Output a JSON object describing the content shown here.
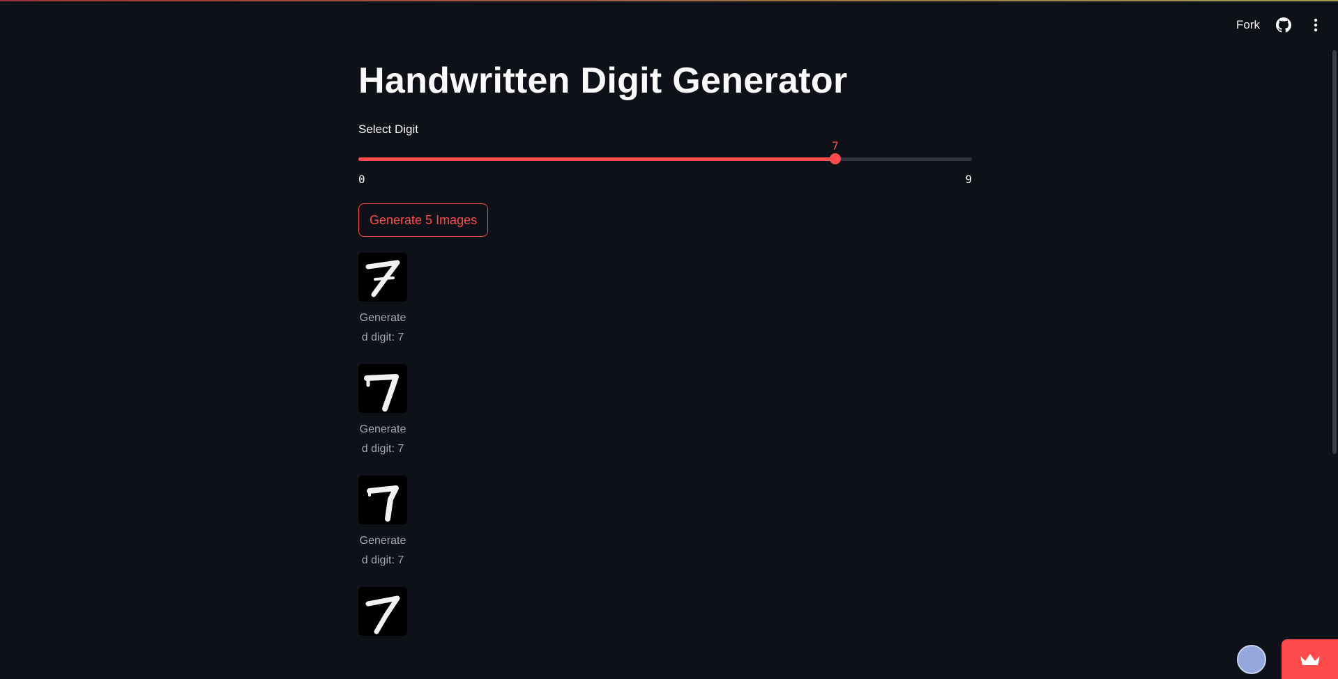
{
  "header": {
    "fork_label": "Fork",
    "github_icon": "github-icon",
    "menu_icon": "kebab-menu-icon"
  },
  "main": {
    "title": "Handwritten Digit Generator",
    "slider": {
      "label": "Select Digit",
      "value": "7",
      "min": "0",
      "max": "9",
      "fill_fraction": 0.7778
    },
    "button_label": "Generate 5 Images",
    "images": [
      {
        "caption": "Generated digit: 7",
        "digit": "7"
      },
      {
        "caption": "Generated digit: 7",
        "digit": "7"
      },
      {
        "caption": "Generated digit: 7",
        "digit": "7"
      },
      {
        "caption": "",
        "digit": "7"
      }
    ]
  },
  "colors": {
    "background": "#0e1117",
    "accent": "#ff4b4b",
    "text": "#fafafa",
    "caption": "#a3a8b4"
  },
  "footer": {
    "avatar_icon": "user-avatar-icon",
    "badge_icon": "crown-icon"
  }
}
